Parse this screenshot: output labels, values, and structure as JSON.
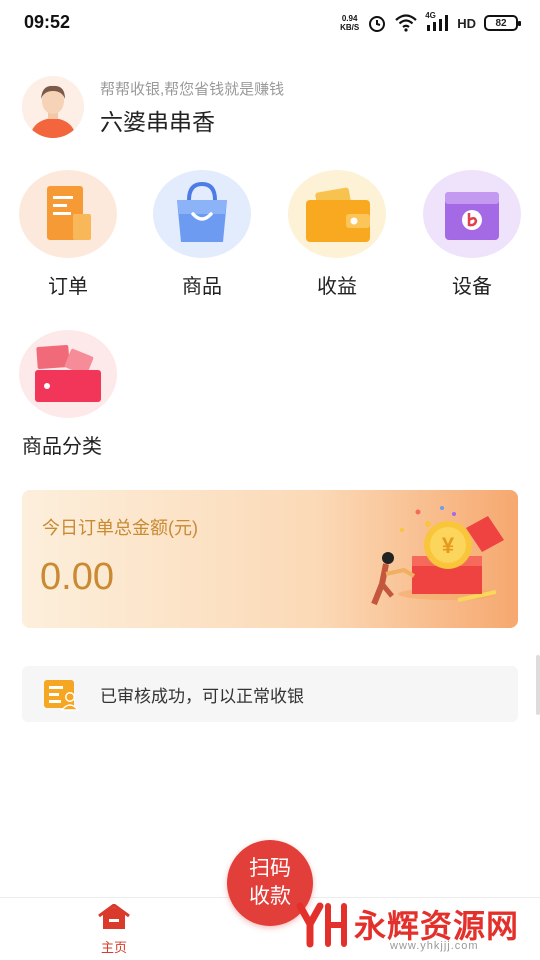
{
  "status_bar": {
    "time": "09:52",
    "net_speed_value": "0.94",
    "net_speed_unit": "KB/S",
    "network": "4G",
    "hd": "HD",
    "battery": "82"
  },
  "profile": {
    "slogan": "帮帮收银,帮您省钱就是赚钱",
    "name": "六婆串串香"
  },
  "features": [
    {
      "label": "订单",
      "icon": "orders-icon"
    },
    {
      "label": "商品",
      "icon": "shopping-bag-icon"
    },
    {
      "label": "收益",
      "icon": "wallet-icon"
    },
    {
      "label": "设备",
      "icon": "device-icon"
    },
    {
      "label": "商品分类",
      "icon": "category-icon"
    }
  ],
  "summary": {
    "title": "今日订单总金额(元)",
    "amount": "0.00",
    "coin_symbol": "¥"
  },
  "notice": {
    "text": "已审核成功，可以正常收银"
  },
  "bottom_nav": {
    "home_label": "主页",
    "scan_line1": "扫码",
    "scan_line2": "收款"
  },
  "watermark": {
    "text": "永辉资源网",
    "url": "www.yhkjjj.com"
  },
  "colors": {
    "accent_red": "#e23f3b",
    "gold_text": "#c98a32"
  }
}
